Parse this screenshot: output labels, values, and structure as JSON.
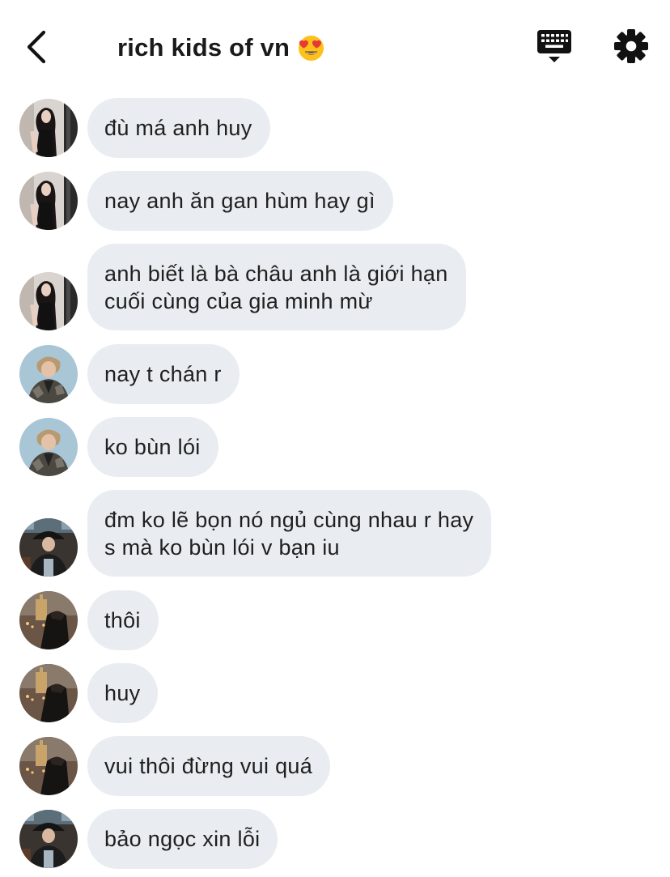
{
  "header": {
    "back_icon": "chevron-left-icon",
    "title": "rich kids of vn",
    "title_emoji": "heart-eyes-emoji",
    "keyboard_icon": "keyboard-icon",
    "settings_icon": "gear-icon"
  },
  "messages": [
    {
      "sender_avatar": "avatar-girl",
      "text": "đù má anh huy"
    },
    {
      "sender_avatar": "avatar-girl",
      "text": "nay anh ăn gan hùm hay gì"
    },
    {
      "sender_avatar": "avatar-girl",
      "text": "anh biết là bà châu anh là giới hạn\ncuối cùng của gia minh mừ"
    },
    {
      "sender_avatar": "avatar-boy-blonde",
      "text": "nay t chán r"
    },
    {
      "sender_avatar": "avatar-boy-blonde",
      "text": "ko bùn lói"
    },
    {
      "sender_avatar": "avatar-boy-hat",
      "text": "đm ko lẽ bọn nó ngủ cùng nhau r hay\ns mà ko bùn lói v bạn iu"
    },
    {
      "sender_avatar": "avatar-boy-city",
      "text": "thôi"
    },
    {
      "sender_avatar": "avatar-boy-city",
      "text": "huy"
    },
    {
      "sender_avatar": "avatar-boy-city",
      "text": "vui thôi đừng vui quá"
    },
    {
      "sender_avatar": "avatar-boy-hat",
      "text": "bảo ngọc xin lỗi"
    }
  ],
  "colors": {
    "bubble_bg": "#e9edf1",
    "text": "#1f1f1f",
    "background": "#ffffff"
  }
}
